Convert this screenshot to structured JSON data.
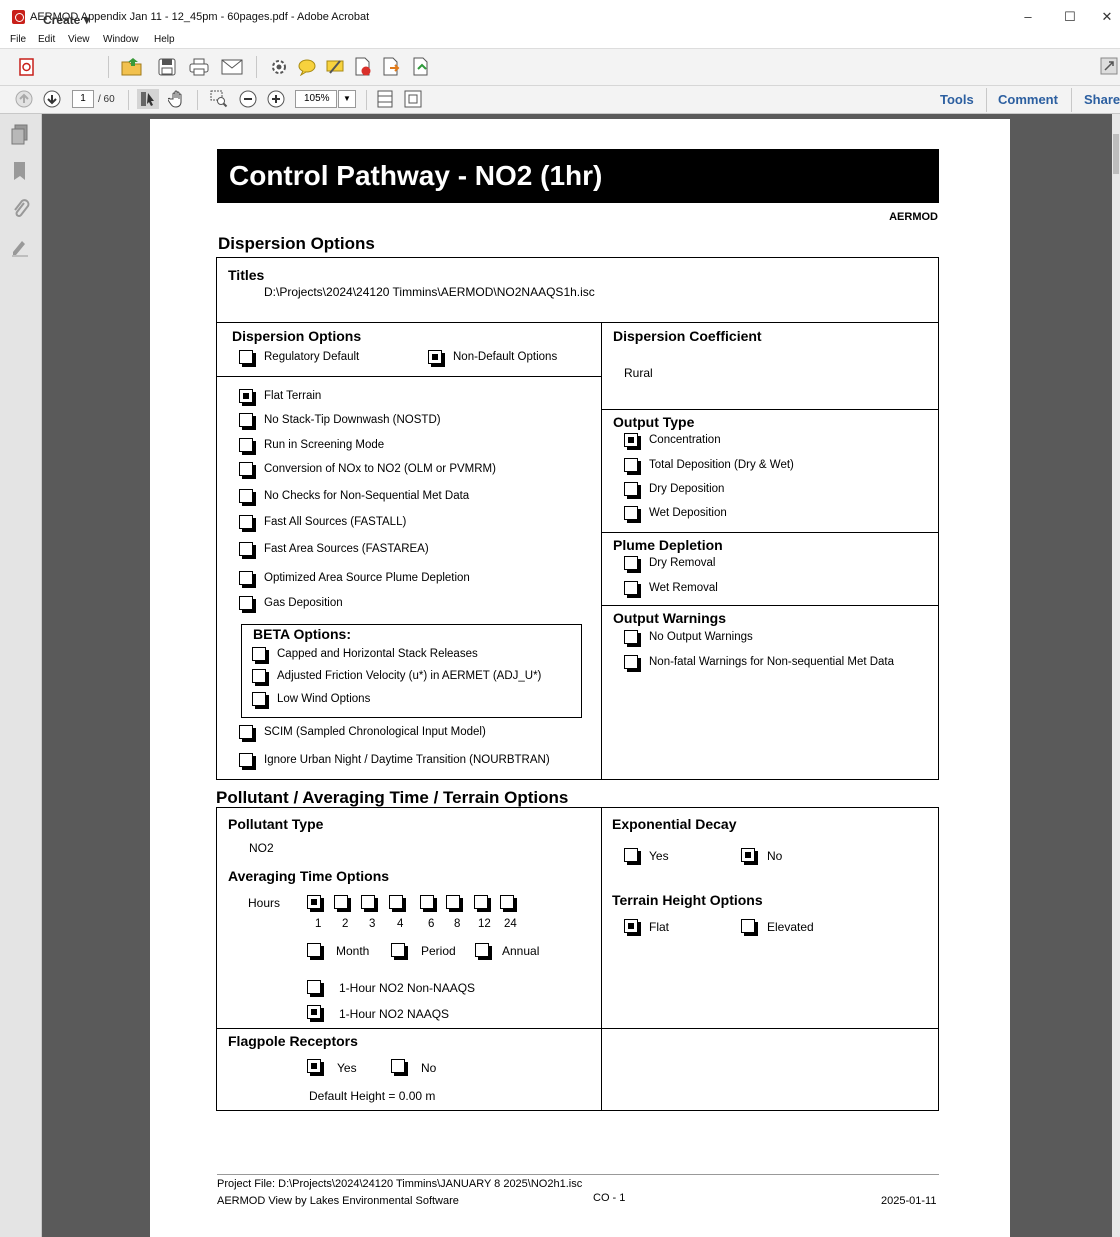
{
  "window": {
    "title": "AERMOD Appendix Jan 11 - 12_45pm - 60pages.pdf - Adobe Acrobat",
    "minimize": "–",
    "maximize": "☐",
    "close": "✕"
  },
  "menu": [
    "File",
    "Edit",
    "View",
    "Window",
    "Help"
  ],
  "toolbar": {
    "create_label": "Create",
    "page_current": "1",
    "page_total": "/ 60",
    "zoom": "105%",
    "right_links": [
      "Tools",
      "Comment",
      "Share"
    ]
  },
  "pdf": {
    "banner_title": "Control Pathway  -  NO2 (1hr)",
    "banner_tag": "AERMOD",
    "dispersion_section_title": "Dispersion Options",
    "titles": {
      "label": "Titles",
      "value": "D:\\Projects\\2024\\24120 Timmins\\AERMOD\\NO2NAAQS1h.isc"
    },
    "dispersion_options": {
      "label": "Dispersion Options",
      "regulatory_default": {
        "label": "Regulatory Default",
        "checked": false
      },
      "non_default": {
        "label": "Non-Default Options",
        "checked": true
      },
      "options": [
        {
          "label": "Flat Terrain",
          "checked": true
        },
        {
          "label": "No Stack-Tip Downwash (NOSTD)",
          "checked": false
        },
        {
          "label": "Run in Screening Mode",
          "checked": false
        },
        {
          "label": "Conversion of NOx to NO2 (OLM or PVMRM)",
          "checked": false
        },
        {
          "label": "No Checks for Non-Sequential Met Data",
          "checked": false
        },
        {
          "label": "Fast All Sources (FASTALL)",
          "checked": false
        },
        {
          "label": "Fast Area Sources (FASTAREA)",
          "checked": false
        },
        {
          "label": "Optimized Area Source Plume Depletion",
          "checked": false
        },
        {
          "label": "Gas Deposition",
          "checked": false
        }
      ],
      "beta_label": "BETA Options:",
      "beta_options": [
        {
          "label": "Capped and Horizontal Stack Releases",
          "checked": false
        },
        {
          "label": "Adjusted Friction Velocity (u*) in AERMET (ADJ_U*)",
          "checked": false
        },
        {
          "label": "Low Wind Options",
          "checked": false
        }
      ],
      "extra_options": [
        {
          "label": "SCIM (Sampled Chronological Input Model)",
          "checked": false
        },
        {
          "label": "Ignore Urban Night / Daytime Transition (NOURBTRAN)",
          "checked": false
        }
      ]
    },
    "dispersion_coefficient": {
      "label": "Dispersion Coefficient",
      "value": "Rural"
    },
    "output_type": {
      "label": "Output Type",
      "options": [
        {
          "label": "Concentration",
          "checked": true
        },
        {
          "label": "Total Deposition (Dry & Wet)",
          "checked": false
        },
        {
          "label": "Dry Deposition",
          "checked": false
        },
        {
          "label": "Wet Deposition",
          "checked": false
        }
      ]
    },
    "plume_depletion": {
      "label": "Plume Depletion",
      "options": [
        {
          "label": "Dry Removal",
          "checked": false
        },
        {
          "label": "Wet Removal",
          "checked": false
        }
      ]
    },
    "output_warnings": {
      "label": "Output Warnings",
      "options": [
        {
          "label": "No Output Warnings",
          "checked": false
        },
        {
          "label": "Non-fatal Warnings for Non-sequential Met Data",
          "checked": false
        }
      ]
    },
    "pollutant_section_title": "Pollutant / Averaging Time / Terrain Options",
    "pollutant_type": {
      "label": "Pollutant Type",
      "value": "NO2"
    },
    "averaging": {
      "label": "Averaging Time Options",
      "hours_label": "Hours",
      "hours": [
        {
          "label": "1",
          "checked": true
        },
        {
          "label": "2",
          "checked": false
        },
        {
          "label": "3",
          "checked": false
        },
        {
          "label": "4",
          "checked": false
        },
        {
          "label": "6",
          "checked": false
        },
        {
          "label": "8",
          "checked": false
        },
        {
          "label": "12",
          "checked": false
        },
        {
          "label": "24",
          "checked": false
        }
      ],
      "month": {
        "label": "Month",
        "checked": false
      },
      "period": {
        "label": "Period",
        "checked": false
      },
      "annual": {
        "label": "Annual",
        "checked": false
      },
      "non_naaqs": {
        "label": "1-Hour NO2 Non-NAAQS",
        "checked": false
      },
      "naaqs": {
        "label": "1-Hour NO2 NAAQS",
        "checked": true
      }
    },
    "exponential_decay": {
      "label": "Exponential Decay",
      "yes": {
        "label": "Yes",
        "checked": false
      },
      "no": {
        "label": "No",
        "checked": true
      }
    },
    "terrain_height": {
      "label": "Terrain Height Options",
      "flat": {
        "label": "Flat",
        "checked": true
      },
      "elevated": {
        "label": "Elevated",
        "checked": false
      }
    },
    "flagpole": {
      "label": "Flagpole Receptors",
      "yes": {
        "label": "Yes",
        "checked": true
      },
      "no": {
        "label": "No",
        "checked": false
      },
      "default_height": "Default Height = 0.00 m"
    },
    "footer": {
      "project_file": "Project File: D:\\Projects\\2024\\24120 Timmins\\JANUARY 8 2025\\NO2h1.isc",
      "software": "AERMOD View by Lakes Environmental Software",
      "page_code": "CO - 1",
      "date": "2025-01-11"
    }
  }
}
